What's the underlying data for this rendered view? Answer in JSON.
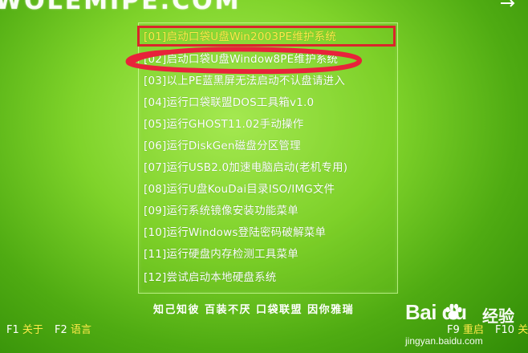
{
  "header": {
    "logo_text": "WOLEMIPE.COM"
  },
  "menu": {
    "items": [
      {
        "label": "[01]启动口袋U盘Win2003PE维护系统",
        "selected": true
      },
      {
        "label": "[02]启动口袋U盘Window8PE维护系统",
        "selected": false
      },
      {
        "label": "[03]以上PE蓝黑屏无法启动不认盘请进入",
        "selected": false
      },
      {
        "label": "[04]运行口袋联盟DOS工具箱v1.0",
        "selected": false
      },
      {
        "label": "[05]运行GHOST11.02手动操作",
        "selected": false
      },
      {
        "label": "[06]运行DiskGen磁盘分区管理",
        "selected": false
      },
      {
        "label": "[07]运行USB2.0加速电脑启动(老机专用)",
        "selected": false
      },
      {
        "label": "[08]运行U盘KouDai目录ISO/IMG文件",
        "selected": false
      },
      {
        "label": "[09]运行系统镜像安装功能菜单",
        "selected": false
      },
      {
        "label": "[10]运行Windows登陆密码破解菜单",
        "selected": false
      },
      {
        "label": "[11]运行硬盘内存检测工具菜单",
        "selected": false
      },
      {
        "label": "[12]尝试启动本地硬盘系统",
        "selected": false
      }
    ]
  },
  "slogan": "知己知彼  百装不厌  口袋联盟  因你雅瑞",
  "footer": {
    "f1_key": "F1",
    "f1_label": "关于",
    "f2_key": "F2",
    "f2_label": "语言",
    "f9_key": "F9",
    "f9_label": "重启",
    "f10_key": "F10",
    "f10_label": "关机"
  },
  "watermark": {
    "logo": "Bai  du",
    "cn": "经验",
    "url": "jingyan.baidu.com"
  },
  "colors": {
    "selected_text": "#ffe94a",
    "highlight_border": "#d9262b",
    "annotation_stroke": "#e8223a"
  }
}
